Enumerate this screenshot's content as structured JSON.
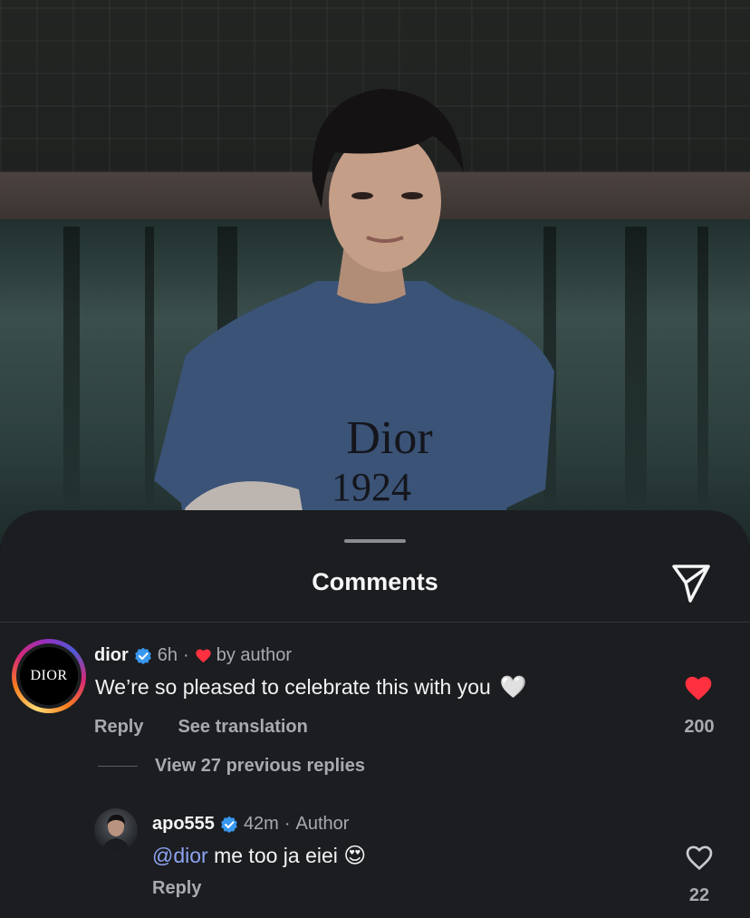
{
  "sheet": {
    "title": "Comments"
  },
  "comments": [
    {
      "username": "dior",
      "time": "6h",
      "separator": "·",
      "liked_by": "by author",
      "text": "We’re so pleased to celebrate this with you",
      "emoji": "🤍",
      "reply_label": "Reply",
      "translate_label": "See translation",
      "likes": "200",
      "avatar_text": "DIOR",
      "liked": true
    }
  ],
  "view_replies": "View 27 previous replies",
  "reply": {
    "username": "apo555",
    "time": "42m",
    "separator": "·",
    "role": "Author",
    "mention": "@dior",
    "text": " me too ja eiei ",
    "emoji": "😍",
    "reply_label": "Reply",
    "likes": "22",
    "liked": false
  },
  "background_image": {
    "shirt_print_line1": "Dior",
    "shirt_print_line2": "1924"
  },
  "colors": {
    "verified": "#3897f0",
    "like_red": "#ff3040",
    "mention": "#8ea4f2",
    "sheet_bg": "#1b1d20"
  },
  "icons": [
    "share-send-icon",
    "verified-badge-icon",
    "heart-filled-icon",
    "heart-outline-icon"
  ]
}
